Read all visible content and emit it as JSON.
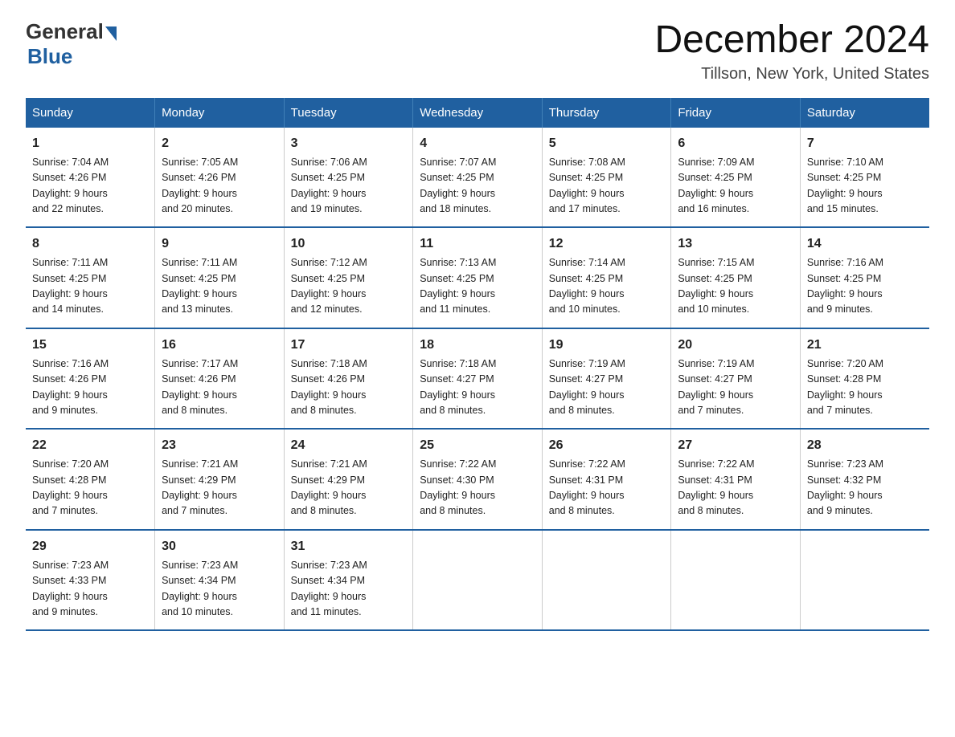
{
  "header": {
    "logo_general": "General",
    "logo_blue": "Blue",
    "main_title": "December 2024",
    "subtitle": "Tillson, New York, United States"
  },
  "days_of_week": [
    "Sunday",
    "Monday",
    "Tuesday",
    "Wednesday",
    "Thursday",
    "Friday",
    "Saturday"
  ],
  "weeks": [
    [
      {
        "day": "1",
        "info": "Sunrise: 7:04 AM\nSunset: 4:26 PM\nDaylight: 9 hours\nand 22 minutes."
      },
      {
        "day": "2",
        "info": "Sunrise: 7:05 AM\nSunset: 4:26 PM\nDaylight: 9 hours\nand 20 minutes."
      },
      {
        "day": "3",
        "info": "Sunrise: 7:06 AM\nSunset: 4:25 PM\nDaylight: 9 hours\nand 19 minutes."
      },
      {
        "day": "4",
        "info": "Sunrise: 7:07 AM\nSunset: 4:25 PM\nDaylight: 9 hours\nand 18 minutes."
      },
      {
        "day": "5",
        "info": "Sunrise: 7:08 AM\nSunset: 4:25 PM\nDaylight: 9 hours\nand 17 minutes."
      },
      {
        "day": "6",
        "info": "Sunrise: 7:09 AM\nSunset: 4:25 PM\nDaylight: 9 hours\nand 16 minutes."
      },
      {
        "day": "7",
        "info": "Sunrise: 7:10 AM\nSunset: 4:25 PM\nDaylight: 9 hours\nand 15 minutes."
      }
    ],
    [
      {
        "day": "8",
        "info": "Sunrise: 7:11 AM\nSunset: 4:25 PM\nDaylight: 9 hours\nand 14 minutes."
      },
      {
        "day": "9",
        "info": "Sunrise: 7:11 AM\nSunset: 4:25 PM\nDaylight: 9 hours\nand 13 minutes."
      },
      {
        "day": "10",
        "info": "Sunrise: 7:12 AM\nSunset: 4:25 PM\nDaylight: 9 hours\nand 12 minutes."
      },
      {
        "day": "11",
        "info": "Sunrise: 7:13 AM\nSunset: 4:25 PM\nDaylight: 9 hours\nand 11 minutes."
      },
      {
        "day": "12",
        "info": "Sunrise: 7:14 AM\nSunset: 4:25 PM\nDaylight: 9 hours\nand 10 minutes."
      },
      {
        "day": "13",
        "info": "Sunrise: 7:15 AM\nSunset: 4:25 PM\nDaylight: 9 hours\nand 10 minutes."
      },
      {
        "day": "14",
        "info": "Sunrise: 7:16 AM\nSunset: 4:25 PM\nDaylight: 9 hours\nand 9 minutes."
      }
    ],
    [
      {
        "day": "15",
        "info": "Sunrise: 7:16 AM\nSunset: 4:26 PM\nDaylight: 9 hours\nand 9 minutes."
      },
      {
        "day": "16",
        "info": "Sunrise: 7:17 AM\nSunset: 4:26 PM\nDaylight: 9 hours\nand 8 minutes."
      },
      {
        "day": "17",
        "info": "Sunrise: 7:18 AM\nSunset: 4:26 PM\nDaylight: 9 hours\nand 8 minutes."
      },
      {
        "day": "18",
        "info": "Sunrise: 7:18 AM\nSunset: 4:27 PM\nDaylight: 9 hours\nand 8 minutes."
      },
      {
        "day": "19",
        "info": "Sunrise: 7:19 AM\nSunset: 4:27 PM\nDaylight: 9 hours\nand 8 minutes."
      },
      {
        "day": "20",
        "info": "Sunrise: 7:19 AM\nSunset: 4:27 PM\nDaylight: 9 hours\nand 7 minutes."
      },
      {
        "day": "21",
        "info": "Sunrise: 7:20 AM\nSunset: 4:28 PM\nDaylight: 9 hours\nand 7 minutes."
      }
    ],
    [
      {
        "day": "22",
        "info": "Sunrise: 7:20 AM\nSunset: 4:28 PM\nDaylight: 9 hours\nand 7 minutes."
      },
      {
        "day": "23",
        "info": "Sunrise: 7:21 AM\nSunset: 4:29 PM\nDaylight: 9 hours\nand 7 minutes."
      },
      {
        "day": "24",
        "info": "Sunrise: 7:21 AM\nSunset: 4:29 PM\nDaylight: 9 hours\nand 8 minutes."
      },
      {
        "day": "25",
        "info": "Sunrise: 7:22 AM\nSunset: 4:30 PM\nDaylight: 9 hours\nand 8 minutes."
      },
      {
        "day": "26",
        "info": "Sunrise: 7:22 AM\nSunset: 4:31 PM\nDaylight: 9 hours\nand 8 minutes."
      },
      {
        "day": "27",
        "info": "Sunrise: 7:22 AM\nSunset: 4:31 PM\nDaylight: 9 hours\nand 8 minutes."
      },
      {
        "day": "28",
        "info": "Sunrise: 7:23 AM\nSunset: 4:32 PM\nDaylight: 9 hours\nand 9 minutes."
      }
    ],
    [
      {
        "day": "29",
        "info": "Sunrise: 7:23 AM\nSunset: 4:33 PM\nDaylight: 9 hours\nand 9 minutes."
      },
      {
        "day": "30",
        "info": "Sunrise: 7:23 AM\nSunset: 4:34 PM\nDaylight: 9 hours\nand 10 minutes."
      },
      {
        "day": "31",
        "info": "Sunrise: 7:23 AM\nSunset: 4:34 PM\nDaylight: 9 hours\nand 11 minutes."
      },
      {
        "day": "",
        "info": ""
      },
      {
        "day": "",
        "info": ""
      },
      {
        "day": "",
        "info": ""
      },
      {
        "day": "",
        "info": ""
      }
    ]
  ]
}
